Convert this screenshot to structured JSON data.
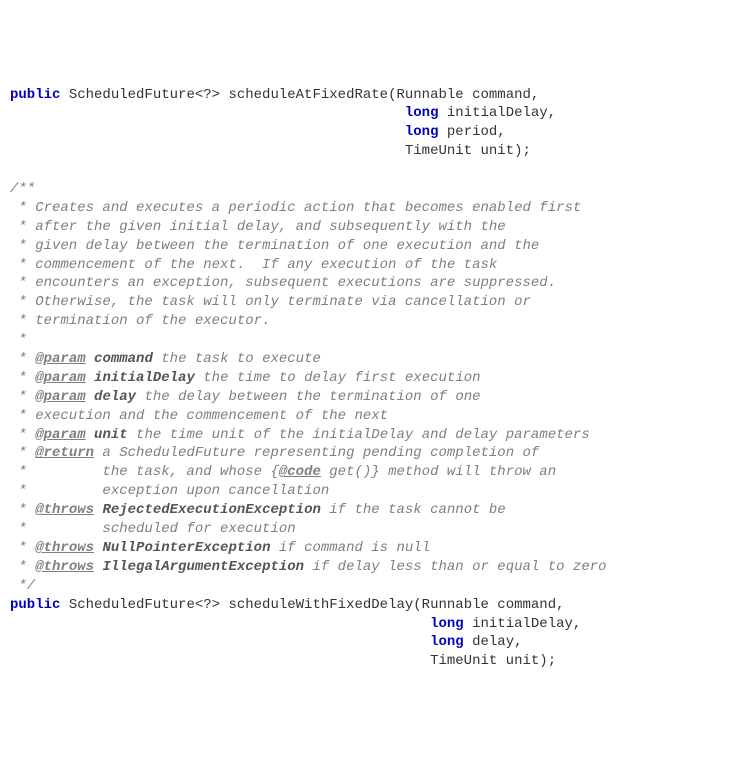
{
  "l1p1": "public",
  "l1p2": " ScheduledFuture<?> scheduleAtFixedRate(Runnable command,",
  "l2p1": "                                               ",
  "l2p2": "long",
  "l2p3": " initialDelay,",
  "l3p1": "                                               ",
  "l3p2": "long",
  "l3p3": " period,",
  "l4p1": "                                               TimeUnit unit);",
  "blank1": "",
  "c1": "/**",
  "c2": " * Creates and executes a periodic action that becomes enabled first",
  "c3": " * after the given initial delay, and subsequently with the",
  "c4": " * given delay between the termination of one execution and the",
  "c5": " * commencement of the next.  If any execution of the task",
  "c6": " * encounters an exception, subsequent executions are suppressed.",
  "c7": " * Otherwise, the task will only terminate via cancellation or",
  "c8": " * termination of the executor.",
  "c9": " *",
  "p1a": " * ",
  "p1tag": "@param",
  "p1sp": " ",
  "p1name": "command",
  "p1desc": " the task to execute",
  "p2a": " * ",
  "p2tag": "@param",
  "p2sp": " ",
  "p2name": "initialDelay",
  "p2desc": " the time to delay first execution",
  "p3a": " * ",
  "p3tag": "@param",
  "p3sp": " ",
  "p3name": "delay",
  "p3desc": " the delay between the termination of one",
  "p3line2": " * execution and the commencement of the next",
  "p4a": " * ",
  "p4tag": "@param",
  "p4sp": " ",
  "p4name": "unit",
  "p4desc": " the time unit of the initialDelay and delay parameters",
  "r1a": " * ",
  "r1tag": "@return",
  "r1desc": " a ScheduledFuture representing pending completion of",
  "r1line2a": " *         the task, and whose {",
  "r1code": "@code",
  "r1line2b": " get()} method will throw an",
  "r1line3": " *         exception upon cancellation",
  "t1a": " * ",
  "t1tag": "@throws",
  "t1sp": " ",
  "t1name": "RejectedExecutionException",
  "t1desc": " if the task cannot be",
  "t1line2": " *         scheduled for execution",
  "t2a": " * ",
  "t2tag": "@throws",
  "t2sp": " ",
  "t2name": "NullPointerException",
  "t2desc": " if command is null",
  "t3a": " * ",
  "t3tag": "@throws",
  "t3sp": " ",
  "t3name": "IllegalArgumentException",
  "t3desc": " if delay less than or equal to zero",
  "cend": " */",
  "m2l1p1": "public",
  "m2l1p2": " ScheduledFuture<?> scheduleWithFixedDelay(Runnable command,",
  "m2l2p1": "                                                  ",
  "m2l2p2": "long",
  "m2l2p3": " initialDelay,",
  "m2l3p1": "                                                  ",
  "m2l3p2": "long",
  "m2l3p3": " delay,",
  "m2l4p1": "                                                  TimeUnit unit);"
}
